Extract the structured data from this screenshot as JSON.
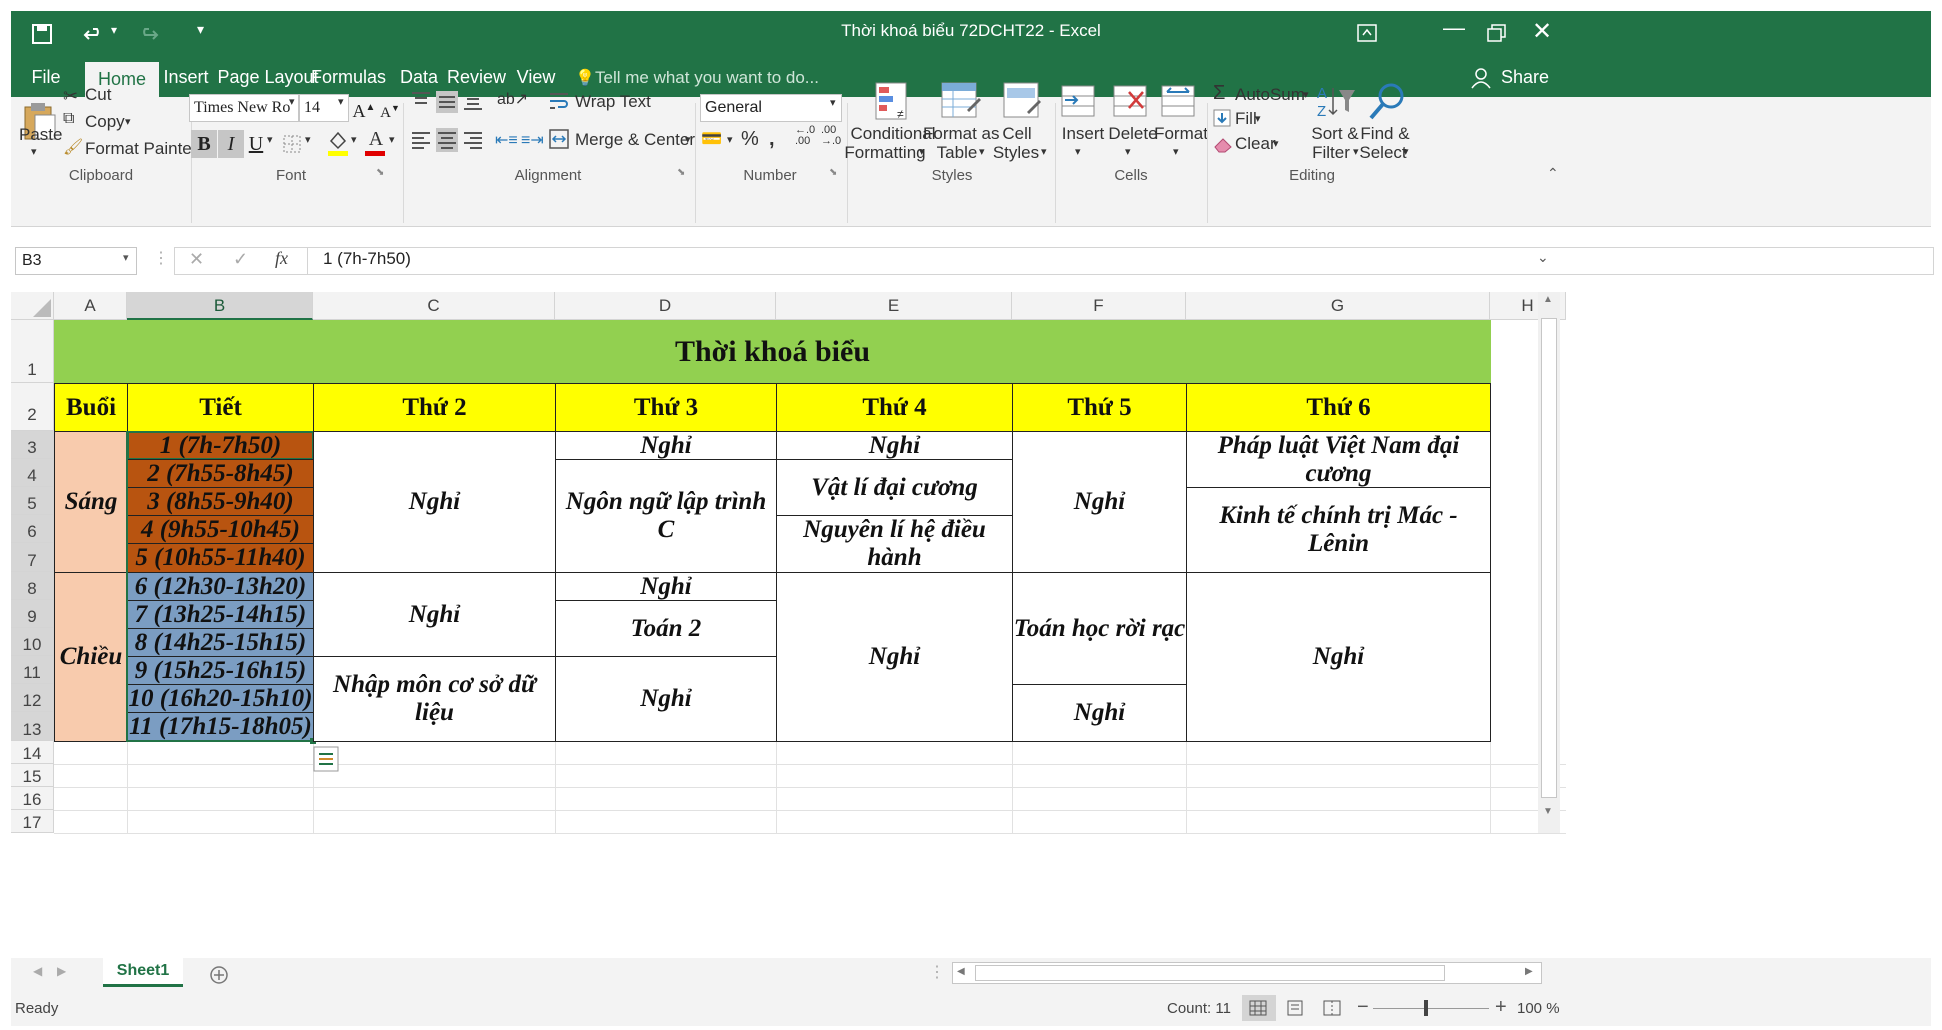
{
  "window": {
    "title": "Thời khoá biểu 72DCHT22 - Excel"
  },
  "tabs": [
    "File",
    "Home",
    "Insert",
    "Page Layout",
    "Formulas",
    "Data",
    "Review",
    "View"
  ],
  "tell_me": "Tell me what you want to do...",
  "share_label": "Share",
  "ribbon": {
    "clipboard": {
      "paste": "Paste",
      "cut": "Cut",
      "copy": "Copy",
      "format_painter": "Format Painter",
      "label": "Clipboard"
    },
    "font": {
      "name": "Times New Ro",
      "size": "14",
      "label": "Font"
    },
    "alignment": {
      "wrap": "Wrap Text",
      "merge": "Merge & Center",
      "label": "Alignment"
    },
    "number": {
      "format": "General",
      "label": "Number"
    },
    "styles": {
      "conditional_1": "Conditional",
      "conditional_2": "Formatting",
      "format_as_1": "Format as",
      "format_as_2": "Table",
      "cell_styles_1": "Cell",
      "cell_styles_2": "Styles",
      "label": "Styles"
    },
    "cells": {
      "insert": "Insert",
      "delete": "Delete",
      "format": "Format",
      "label": "Cells"
    },
    "editing": {
      "autosum": "AutoSum",
      "fill": "Fill",
      "clear": "Clear",
      "sort_1": "Sort &",
      "sort_2": "Filter",
      "find_1": "Find &",
      "find_2": "Select",
      "label": "Editing"
    }
  },
  "formula_bar": {
    "name_box": "B3",
    "formula": "1 (7h-7h50)"
  },
  "columns": [
    "A",
    "B",
    "C",
    "D",
    "E",
    "F",
    "G",
    "H"
  ],
  "rows": [
    "1",
    "2",
    "3",
    "4",
    "5",
    "6",
    "7",
    "8",
    "9",
    "10",
    "11",
    "12",
    "13",
    "14",
    "15",
    "16",
    "17"
  ],
  "sheet": {
    "title": "Thời khoá biểu",
    "headers": [
      "Buổi",
      "Tiết",
      "Thứ 2",
      "Thứ 3",
      "Thứ 4",
      "Thứ 5",
      "Thứ 6"
    ],
    "sessions": [
      "Sáng",
      "Chiều"
    ],
    "periods": [
      "1 (7h-7h50)",
      "2 (7h55-8h45)",
      "3 (8h55-9h40)",
      "4 (9h55-10h45)",
      "5 (10h55-11h40)",
      "6 (12h30-13h20)",
      "7 (13h25-14h15)",
      "8 (14h25-15h15)",
      "9 (15h25-16h15)",
      "10 (16h20-15h10)",
      "11 (17h15-18h05)"
    ],
    "mon_morning": "Nghỉ",
    "mon_aft1": "Nghỉ",
    "mon_aft2": "Nhập môn cơ sở dữ liệu",
    "tue_1": "Nghỉ",
    "tue_2": "Ngôn ngữ lập trình C",
    "tue_3": "Nghỉ",
    "tue_4": "Toán 2",
    "tue_5": "Nghỉ",
    "wed_1": "Nghỉ",
    "wed_2": "Vật lí đại cương",
    "wed_3": "Nguyên lí hệ điều hành",
    "wed_4": "Nghỉ",
    "thu_1": "Nghỉ",
    "thu_2": "Toán học rời rạc",
    "thu_3": "Nghỉ",
    "fri_1": "Pháp luật Việt Nam đại cương",
    "fri_2": "Kinh tế chính trị Mác - Lênin",
    "fri_3": "Nghỉ"
  },
  "sheet_tab": "Sheet1",
  "status": {
    "ready": "Ready",
    "count": "Count: 11",
    "zoom": "100 %"
  },
  "colors": {
    "excel_green": "#217346",
    "title_fill": "#92d050",
    "header_fill": "#ffff00",
    "session_fill": "#f8cbad",
    "morning_fill": "#b85410",
    "afternoon_fill": "#7b9dc2"
  }
}
